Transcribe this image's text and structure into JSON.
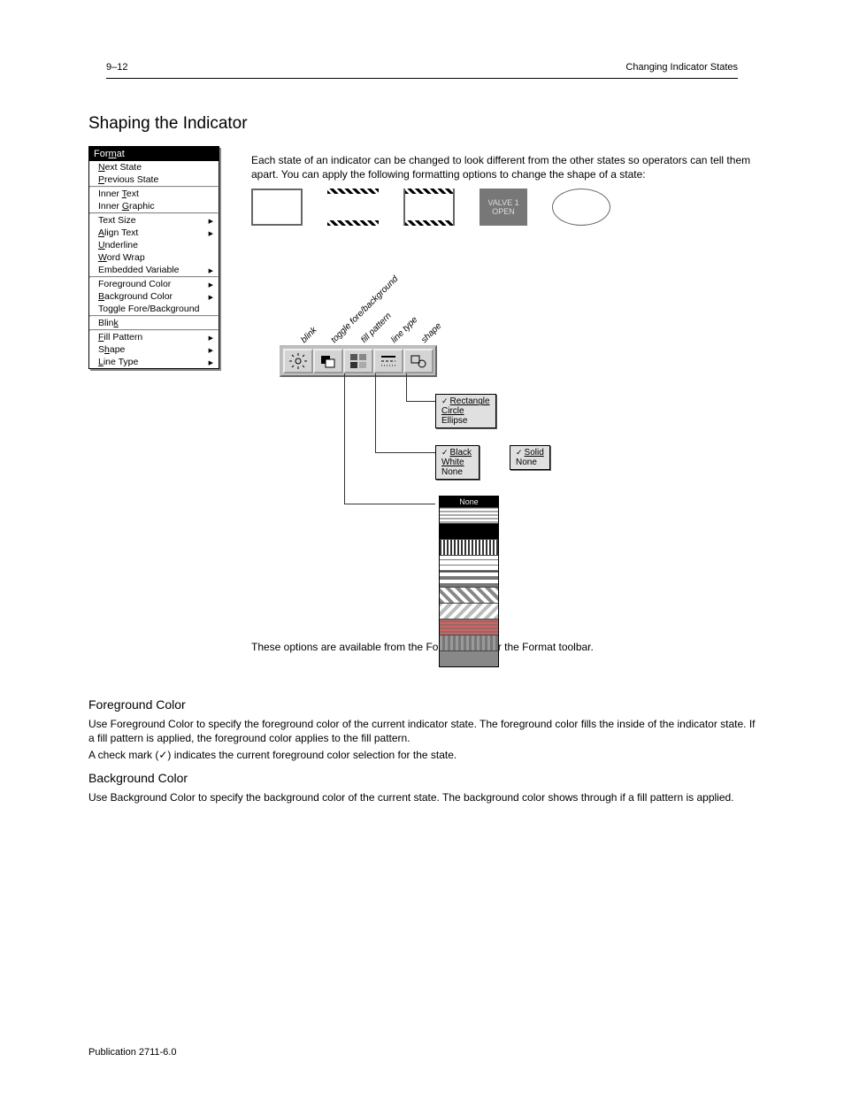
{
  "header": {
    "left": "9–12",
    "right": "Changing Indicator States"
  },
  "heading": "Shaping the Indicator",
  "intro_p1": "Each state of an indicator can be changed to look different from the other states so operators can tell them apart. You can apply the following formatting options to change the shape of a state:",
  "menu": {
    "title_parts": [
      "For",
      "m",
      "at"
    ],
    "g1": [
      {
        "u": "N",
        "rest": "ext State",
        "arrow": false
      },
      {
        "u": "P",
        "rest": "revious State",
        "arrow": false
      }
    ],
    "g2": [
      {
        "pre": "Inner ",
        "u": "T",
        "rest": "ext",
        "arrow": false
      },
      {
        "pre": "Inner ",
        "u": "G",
        "rest": "raphic",
        "arrow": false
      }
    ],
    "g3": [
      {
        "pre": "Text Size",
        "arrow": true
      },
      {
        "u": "A",
        "rest": "lign Text",
        "arrow": true
      },
      {
        "u": "U",
        "rest": "nderline",
        "arrow": false
      },
      {
        "u": "W",
        "rest": "ord Wrap",
        "arrow": false
      },
      {
        "pre": "Embedded Variable",
        "arrow": true
      }
    ],
    "g4": [
      {
        "pre": "Foreground Color",
        "arrow": true
      },
      {
        "u": "B",
        "rest": "ackground Color",
        "arrow": true
      },
      {
        "pre": "Toggle Fore/Background",
        "arrow": false
      }
    ],
    "g5": [
      {
        "pre": "Blin",
        "u": "k",
        "rest": "",
        "arrow": false
      }
    ],
    "g6": [
      {
        "u": "F",
        "rest": "ill Pattern",
        "arrow": true
      },
      {
        "pre": "S",
        "u": "h",
        "rest": "ape",
        "arrow": true
      },
      {
        "u": "L",
        "rest": "ine Type",
        "arrow": true
      }
    ]
  },
  "shape_valve": {
    "l1": "VALVE 1",
    "l2": "OPEN"
  },
  "toolbar_labels": [
    "blink",
    "toggle fore/background",
    "fill pattern",
    "line type",
    "shape"
  ],
  "toolbar_icons": [
    "sun-icon",
    "toggle-fb-icon",
    "fillpattern-icon",
    "linetype-icon",
    "shape-icon"
  ],
  "popup_shape": {
    "items": [
      "Rectangle",
      "Circle",
      "Ellipse"
    ],
    "checked": 0
  },
  "popup_linetype": {
    "items": [
      "Solid",
      "None"
    ],
    "checked": 0
  },
  "popup_color": {
    "items": [
      "Black",
      "White",
      "None"
    ],
    "checked": 0
  },
  "pattern_header": "None",
  "toolbar_note": "These options are available from the Format menu or the Format toolbar.",
  "fg": {
    "title": "Foreground Color",
    "p1": "Use Foreground Color to specify the foreground color of the current indicator state. The foreground color fills the inside of the indicator state. If a fill pattern is applied, the foreground color applies to the fill pattern.",
    "p2": "A check mark (✓) indicates the current foreground color selection for the state."
  },
  "bg": {
    "title": "Background Color",
    "p1": "Use Background Color to specify the background color of the current state. The background color shows through if a fill pattern is applied."
  },
  "footer": {
    "left": "Publication 2711-6.0",
    "right": ""
  }
}
